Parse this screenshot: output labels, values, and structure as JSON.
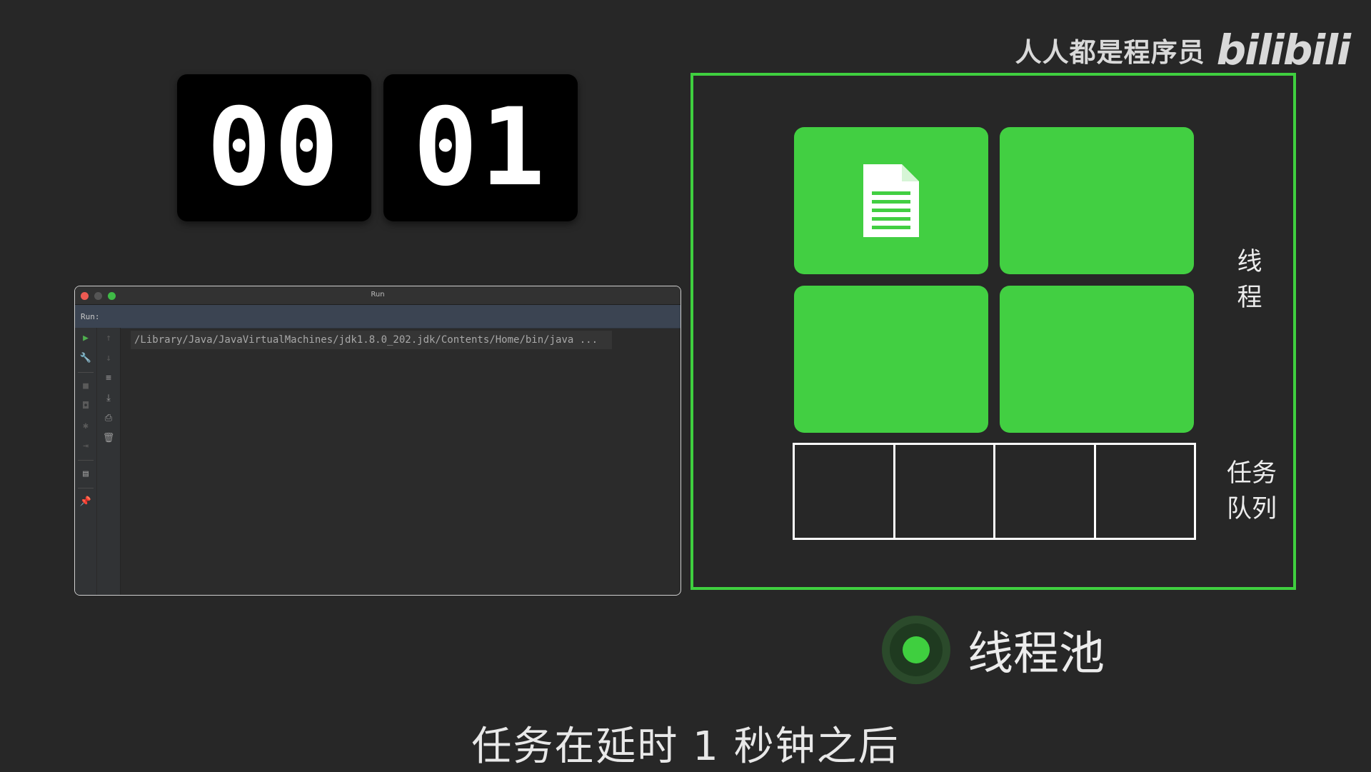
{
  "watermark": {
    "channel": "人人都是程序员",
    "logo": "bilibili"
  },
  "clock": {
    "minutes": "00",
    "seconds": "01"
  },
  "ide": {
    "window_title": "Run",
    "run_label": "Run:",
    "command": "/Library/Java/JavaVirtualMachines/jdk1.8.0_202.jdk/Contents/Home/bin/java ..."
  },
  "diagram": {
    "thread_label": "线\n程",
    "queue_label": "任务\n队列",
    "legend": "线程池"
  },
  "subtitle": "任务在延时 1 秒钟之后",
  "colors": {
    "accent": "#42cf42",
    "background": "#272727"
  }
}
